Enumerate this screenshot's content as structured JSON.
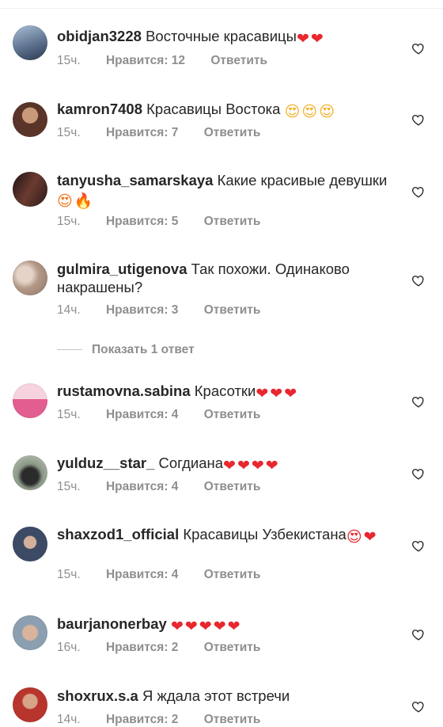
{
  "comments": [
    {
      "username": "obidjan3228",
      "text": "Восточные красавицы",
      "emoji": "❤️❤️",
      "emoji_glyph": "❤❤",
      "time": "15ч.",
      "likes": "Нравится: 12",
      "reply": "Ответить",
      "avatar_color": "#5b6e8a"
    },
    {
      "username": "kamron7408",
      "text": "Красавицы Востока",
      "emoji": "😍😍😍",
      "emoji_glyph": "😍😍😍",
      "time": "15ч.",
      "likes": "Нравится: 7",
      "reply": "Ответить",
      "avatar_color": "#7a4a3a"
    },
    {
      "username": "tanyusha_samarskaya",
      "text": "Какие красивые девушки",
      "emoji": "😍🔥",
      "emoji_glyph": "😍🔥",
      "time": "15ч.",
      "likes": "Нравится: 5",
      "reply": "Ответить",
      "avatar_color": "#3a2a2a"
    },
    {
      "username": "gulmira_utigenova",
      "text": "Так похожи. Одинаково накрашены?",
      "emoji": "",
      "emoji_glyph": "",
      "time": "14ч.",
      "likes": "Нравится: 3",
      "reply": "Ответить",
      "avatar_color": "#c9b3a4"
    },
    {
      "username": "rustamovna.sabina",
      "text": "Красотки",
      "emoji": "❤️❤️❤️",
      "emoji_glyph": "❤❤❤",
      "time": "15ч.",
      "likes": "Нравится: 4",
      "reply": "Ответить",
      "avatar_color": "#e07aa2"
    },
    {
      "username": "yulduz__star_",
      "text": "Согдиана",
      "emoji": "❤️❤️❤️❤️",
      "emoji_glyph": "❤❤❤❤",
      "time": "15ч.",
      "likes": "Нравится: 4",
      "reply": "Ответить",
      "avatar_color": "#6f7a6a"
    },
    {
      "username": "shaxzod1_official",
      "text": "Красавицы Узбекистана",
      "emoji": "😍❤️",
      "emoji_glyph": "😍❤",
      "time": "15ч.",
      "likes": "Нравится: 4",
      "reply": "Ответить",
      "avatar_color": "#4f5f7a"
    },
    {
      "username": "baurjanonerbay",
      "text": "",
      "emoji": "❤️❤️❤️❤️❤️",
      "emoji_glyph": "❤❤❤❤❤",
      "time": "16ч.",
      "likes": "Нравится: 2",
      "reply": "Ответить",
      "avatar_color": "#8a9aa8"
    },
    {
      "username": "shoxrux.s.a",
      "text": "Я ждала этот встречи",
      "emoji": "",
      "emoji_glyph": "",
      "time": "14ч.",
      "likes": "Нравится: 2",
      "reply": "Ответить",
      "avatar_color": "#b8352e"
    }
  ],
  "show_replies": "Показать 1 ответ",
  "icons": {
    "like": "heart-outline-icon"
  },
  "colors": {
    "meta_text": "#8e8e8e",
    "body_text": "#262626",
    "heart_red": "#e8272f"
  }
}
